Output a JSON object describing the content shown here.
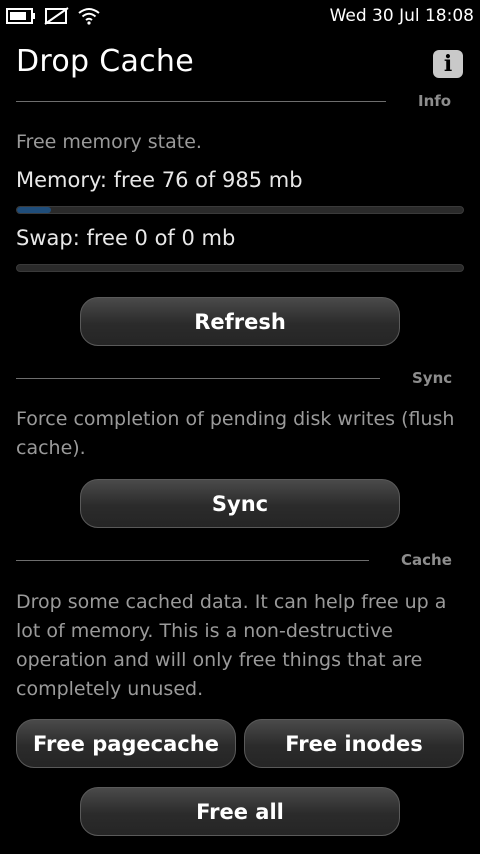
{
  "status_bar": {
    "datetime": "Wed 30 Jul 18:08",
    "icons": [
      "battery-icon",
      "sim-off-icon",
      "wifi-icon"
    ]
  },
  "header": {
    "title": "Drop Cache",
    "info_icon": "i"
  },
  "sections": {
    "info": {
      "label": "Info",
      "subtitle": "Free memory state.",
      "memory_text": "Memory: free 76 of 985 mb",
      "memory_free_fraction": 0.077,
      "swap_text": "Swap: free 0 of 0 mb",
      "swap_free_fraction": 0,
      "refresh_label": "Refresh"
    },
    "sync": {
      "label": "Sync",
      "description": "Force completion of pending disk writes (flush cache).",
      "sync_label": "Sync"
    },
    "cache": {
      "label": "Cache",
      "description": "Drop some cached data. It can help free up a lot of memory. This is a non-destructive operation and will only free things that are completely unused.",
      "free_pagecache_label": "Free pagecache",
      "free_inodes_label": "Free inodes",
      "free_all_label": "Free all"
    }
  },
  "colors": {
    "background": "#000000",
    "progress_fill": "#1f4d7a"
  }
}
